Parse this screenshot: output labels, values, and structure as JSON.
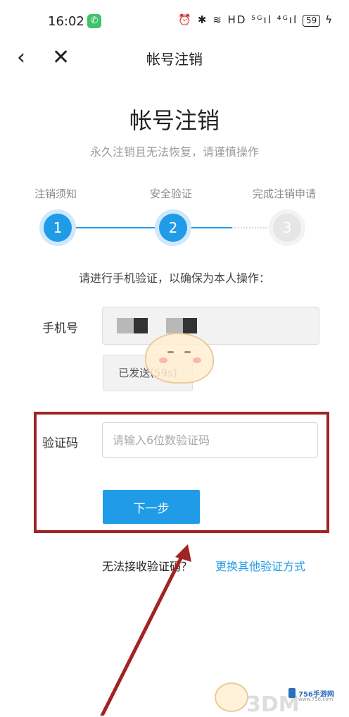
{
  "status_bar": {
    "time": "16:02",
    "icons": "⏰ ✱ ≋ HD ⁵ᴳıl ⁴ᴳıl",
    "battery": "59"
  },
  "nav": {
    "back_icon": "‹",
    "close_icon": "✕",
    "title": "帐号注销"
  },
  "header": {
    "title": "帐号注销",
    "subtitle": "永久注销且无法恢复，请谨慎操作"
  },
  "steps": [
    {
      "label": "注销须知",
      "number": "1",
      "state": "done"
    },
    {
      "label": "安全验证",
      "number": "2",
      "state": "current"
    },
    {
      "label": "完成注销申请",
      "number": "3",
      "state": "pending"
    }
  ],
  "form": {
    "instruction": "请进行手机验证，以确保为本人操作：",
    "phone_label": "手机号",
    "sent_button": "已发送(59s)",
    "code_label": "验证码",
    "code_placeholder": "请输入6位数验证码",
    "next_button": "下一步"
  },
  "footer": {
    "cannot_receive": "无法接收验证码？",
    "alt_method_link": "更换其他验证方式"
  },
  "watermark": {
    "site": "756手游网",
    "site_sub": "www.756.com",
    "brand": "3DM"
  },
  "colors": {
    "accent": "#1f9be8",
    "highlight_border": "#a12424"
  }
}
